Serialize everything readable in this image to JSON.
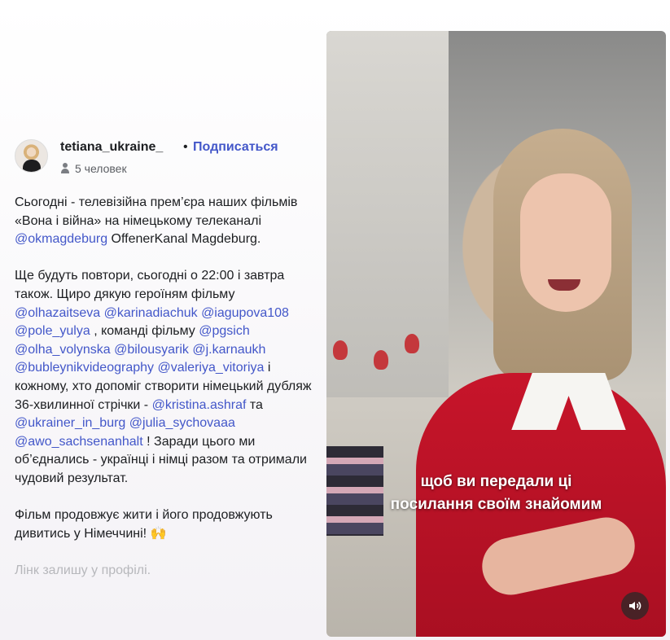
{
  "author": {
    "username": "tetiana_ukraine_",
    "separator": "•",
    "subscribe_label": "Подписаться",
    "followers_text": "5 человек",
    "avatar_icon": "avatar",
    "people_icon": "person-icon"
  },
  "caption": {
    "p1": [
      {
        "t": "text",
        "v": "Сьогодні - телевізійна прем’єра наших фільмів «Вона і війна» на німецькому телеканалі "
      },
      {
        "t": "mention",
        "v": "@okmagdeburg"
      },
      {
        "t": "text",
        "v": " OffenerKanal Magdeburg."
      }
    ],
    "p2": [
      {
        "t": "text",
        "v": "Ще будуть повтори, сьогодні о 22:00 і завтра також. Щиро дякую героїням фільму "
      },
      {
        "t": "mention",
        "v": "@olhazaitseva"
      },
      {
        "t": "text",
        "v": " "
      },
      {
        "t": "mention",
        "v": "@karinadiachuk"
      },
      {
        "t": "text",
        "v": " "
      },
      {
        "t": "mention",
        "v": "@iagupova108"
      },
      {
        "t": "text",
        "v": " "
      },
      {
        "t": "mention",
        "v": "@pole_yulya"
      },
      {
        "t": "text",
        "v": " , команді фільму "
      },
      {
        "t": "mention",
        "v": "@pgsich"
      },
      {
        "t": "text",
        "v": " "
      },
      {
        "t": "mention",
        "v": "@olha_volynska"
      },
      {
        "t": "text",
        "v": " "
      },
      {
        "t": "mention",
        "v": "@bilousyarik"
      },
      {
        "t": "text",
        "v": " "
      },
      {
        "t": "mention",
        "v": "@j.karnaukh"
      },
      {
        "t": "text",
        "v": " "
      },
      {
        "t": "mention",
        "v": "@bubleynikvideography"
      },
      {
        "t": "text",
        "v": " "
      },
      {
        "t": "mention",
        "v": "@valeriya_vitoriya"
      },
      {
        "t": "text",
        "v": " і кожному, хто допоміг створити німецький дубляж 36-хвилинної стрічки - "
      },
      {
        "t": "mention",
        "v": "@kristina.ashraf"
      },
      {
        "t": "text",
        "v": " та "
      },
      {
        "t": "mention",
        "v": "@ukrainer_in_burg"
      },
      {
        "t": "text",
        "v": " "
      },
      {
        "t": "mention",
        "v": "@julia_sychovaaa"
      },
      {
        "t": "text",
        "v": " "
      },
      {
        "t": "mention",
        "v": "@awo_sachsenanhalt"
      },
      {
        "t": "text",
        "v": " ! Заради цього ми об’єднались - українці і німці разом та отримали чудовий результат."
      }
    ],
    "p3": [
      {
        "t": "text",
        "v": "Фільм продовжує жити і його продовжують дивитись у Німеччині! 🙌"
      }
    ],
    "p4": "Лінк залишу у профілі."
  },
  "video": {
    "subtitle_line1": "щоб ви передали ці",
    "subtitle_line2": "посилання своїм знайомим",
    "sound_icon": "sound-on-icon"
  }
}
